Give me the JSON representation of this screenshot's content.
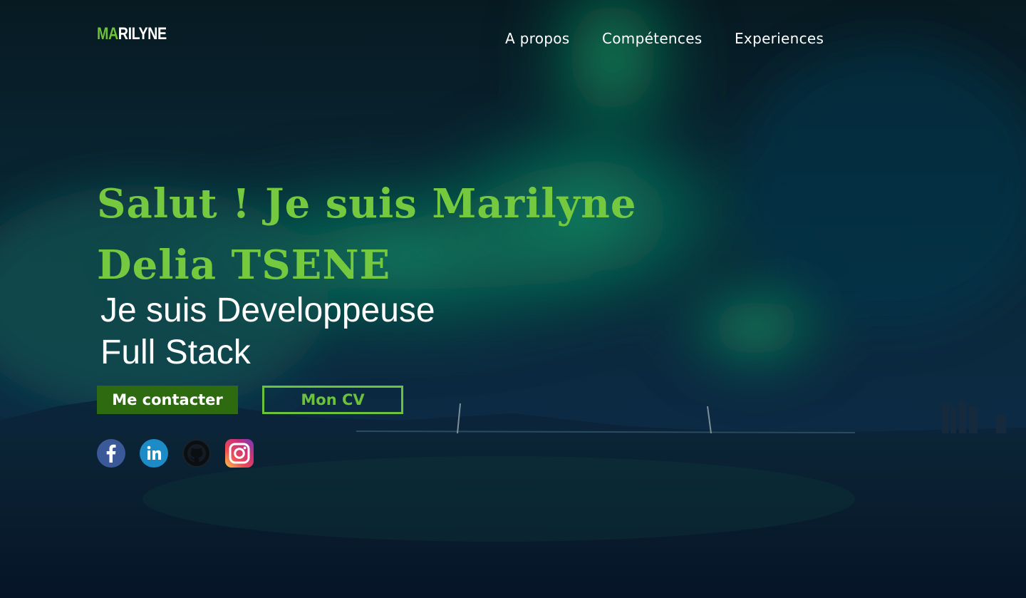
{
  "brand": {
    "logo_accent": "MA",
    "logo_rest": "RILYNE",
    "accent_color": "#6cc23a"
  },
  "nav": {
    "items": [
      {
        "label": "A propos"
      },
      {
        "label": "Compétences"
      },
      {
        "label": "Experiences"
      }
    ]
  },
  "hero": {
    "title_line1": "Salut ! Je suis Marilyne",
    "title_line2": "Delia TSENE",
    "subtitle_line1": "Je suis Developpeuse",
    "subtitle_line2": "Full Stack",
    "title_color": "#75c93f"
  },
  "buttons": {
    "contact_label": "Me contacter",
    "cv_label": "Mon CV",
    "contact_bg": "#2e6b10"
  },
  "socials": [
    {
      "icon": "facebook-icon"
    },
    {
      "icon": "linkedin-icon"
    },
    {
      "icon": "github-icon"
    },
    {
      "icon": "instagram-icon"
    }
  ],
  "background": {
    "description_icon": "aurora-night-sky-background"
  }
}
